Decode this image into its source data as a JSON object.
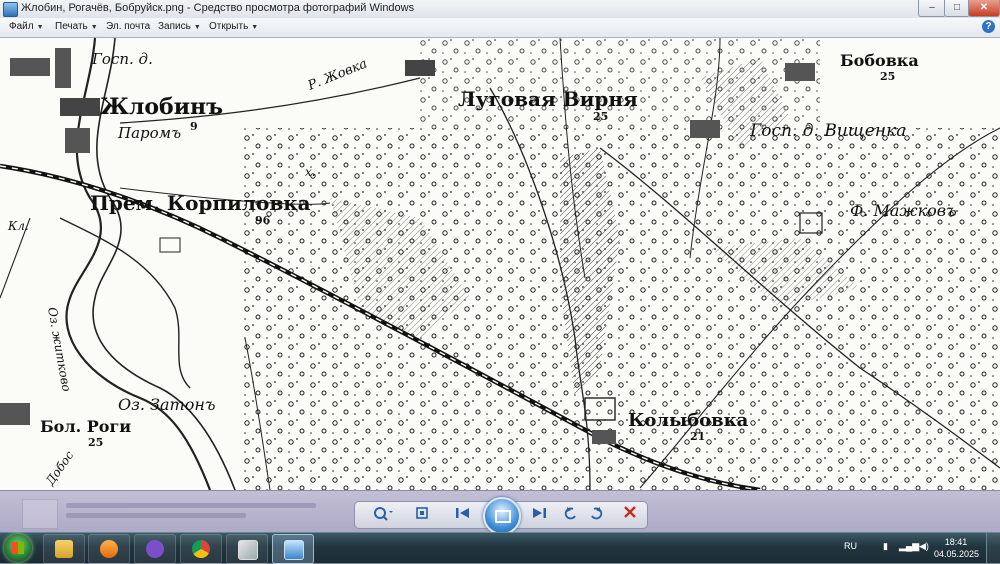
{
  "window": {
    "title": "Жлобин, Рогачёв, Бобруйск.png - Средство просмотра фотографий Windows"
  },
  "menu": {
    "items": [
      {
        "label": "Файл",
        "caret": "▼"
      },
      {
        "label": "Печать",
        "caret": "▼"
      },
      {
        "label": "Эл. почта",
        "caret": ""
      },
      {
        "label": "Запись",
        "caret": "▼"
      },
      {
        "label": "Открыть",
        "caret": "▼"
      }
    ],
    "help_glyph": "?"
  },
  "window_controls": {
    "minimize": "–",
    "maximize": "□",
    "close": "✕"
  },
  "map": {
    "labels": {
      "zhlobin": "Жлобинъ",
      "parom": "Паромъ",
      "gosp": "Госп. д.",
      "r_zhovka": "Р. Жовка",
      "lugovaya_virnya": "Луговая Вирня",
      "lugovaya_num": "25",
      "bobovka": "Бобовка",
      "bobovka_num": "25",
      "gosp_vishchenka": "Госп. д. Вищенка",
      "prem_korpilovka": "Прем. Корпиловка",
      "korpilovka_num": "96",
      "f_mazhkov": "Ф. Мажковъ",
      "oz_zaton": "Оз. Затонъ",
      "bol_rogi": "Бол. Роги",
      "bol_rogi_num": "25",
      "kolybovka": "Колыбовка",
      "kolybovka_num": "21",
      "kl": "Кл.",
      "kl2": "Кл.",
      "nr": "25",
      "parom_num": "9",
      "x_mark": "х.",
      "oz_vertical": "Оз. житково",
      "dobos": "Добос"
    }
  },
  "viewer_controls": {
    "zoom": "zoom-icon",
    "fit": "fit-window-icon",
    "prev": "previous-icon",
    "slideshow": "slideshow-icon",
    "next": "next-icon",
    "rotate_ccw": "rotate-left-icon",
    "rotate_cw": "rotate-right-icon",
    "delete": "delete-icon"
  },
  "taskbar": {
    "apps": [
      "explorer-icon",
      "media-player-icon",
      "viber-icon",
      "chrome-icon",
      "paint-icon",
      "photo-viewer-icon"
    ],
    "language": "RU",
    "time": "18:41",
    "date": "04.05.2025"
  },
  "colors": {
    "accent": "#2f73c8",
    "close": "#c63d22",
    "taskbar": "#22353f"
  }
}
